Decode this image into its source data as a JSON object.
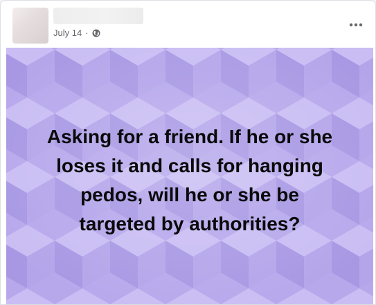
{
  "post": {
    "date": "July 14",
    "separator": "·",
    "privacy_icon": "globe-icon",
    "more_icon": "more-options-icon",
    "image_text_lines": [
      "Asking for a friend. If he or she",
      "loses it and calls for hanging",
      "pedos, will he or she be",
      "targeted by authorities?"
    ]
  },
  "colors": {
    "background_purple": "#b7a8ec",
    "text": "#0a0a0a",
    "meta_text": "#65676b"
  }
}
